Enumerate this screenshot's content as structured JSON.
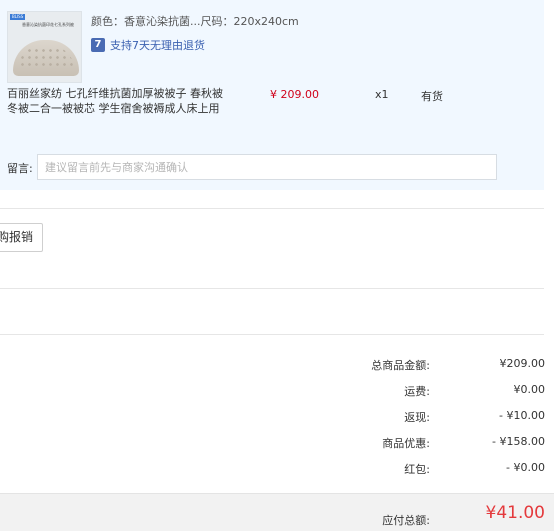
{
  "product": {
    "thumbnail_badge": "BLISS",
    "thumbnail_caption": "香意沁染抗菌印花七孔系列被",
    "spec": "颜色：香意沁染抗菌...尺码：220x240cm",
    "refund_text": "支持7天无理由退货",
    "refund_icon_glyph": "7",
    "title": "百丽丝家纺 七孔纤维抗菌加厚被被子 春秋被冬被二合一被被芯 学生宿舍被褥成人床上用",
    "price": "¥ 209.00",
    "quantity": "x1",
    "stock": "有货"
  },
  "message": {
    "label": "留言:",
    "placeholder": "建议留言前先与商家沟通确认"
  },
  "reimbursement": {
    "button_label": "购报销"
  },
  "summary": {
    "rows": [
      {
        "label": "总商品金额:",
        "value": "¥209.00"
      },
      {
        "label": "运费:",
        "value": "¥0.00"
      },
      {
        "label": "返现:",
        "value": "- ¥10.00"
      },
      {
        "label": "商品优惠:",
        "value": "- ¥158.00"
      },
      {
        "label": "红包:",
        "value": "- ¥0.00"
      }
    ],
    "total_label": "应付总额:",
    "total_value": "¥41.00"
  },
  "colors": {
    "panel_bg": "#f1f8ff",
    "price_red": "#d0021b",
    "total_red": "#e4393c",
    "link_blue": "#3a60b0"
  },
  "icons": {
    "refund": "seven-day-return-icon"
  }
}
